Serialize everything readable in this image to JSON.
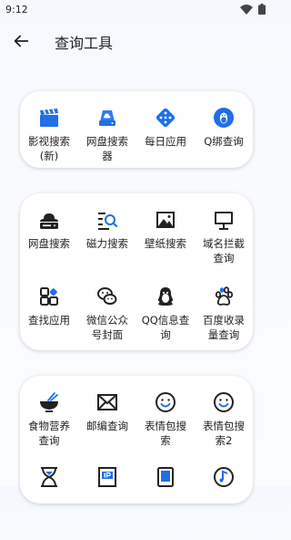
{
  "status": {
    "time": "9:12"
  },
  "header": {
    "title": "查询工具"
  },
  "accent": "#1e6fe8",
  "sections": [
    {
      "items": [
        {
          "label": "影视搜索(新)",
          "icon": "clapperboard-icon"
        },
        {
          "label": "网盘搜索器",
          "icon": "cloud-drive-icon"
        },
        {
          "label": "每日应用",
          "icon": "dice-icon"
        },
        {
          "label": "Q绑查询",
          "icon": "qq-penguin-icon"
        }
      ]
    },
    {
      "items": [
        {
          "label": "网盘搜索",
          "icon": "cloud-server-icon"
        },
        {
          "label": "磁力搜索",
          "icon": "list-search-icon"
        },
        {
          "label": "壁纸搜索",
          "icon": "image-icon"
        },
        {
          "label": "域名拦截查询",
          "icon": "monitor-icon"
        },
        {
          "label": "查找应用",
          "icon": "apps-grid-icon"
        },
        {
          "label": "微信公众号封面",
          "icon": "wechat-icon"
        },
        {
          "label": "QQ信息查询",
          "icon": "qq-icon"
        },
        {
          "label": "百度收录量查询",
          "icon": "paw-icon"
        }
      ]
    },
    {
      "items": [
        {
          "label": "食物营养查询",
          "icon": "bowl-icon"
        },
        {
          "label": "邮编查询",
          "icon": "envelope-icon"
        },
        {
          "label": "表情包搜索",
          "icon": "smiley-icon"
        },
        {
          "label": "表情包搜索2",
          "icon": "smiley-icon"
        },
        {
          "label": "",
          "icon": "hourglass-icon"
        },
        {
          "label": "",
          "icon": "ip-icon"
        },
        {
          "label": "",
          "icon": "tablet-icon"
        },
        {
          "label": "",
          "icon": "music-disc-icon"
        }
      ]
    }
  ]
}
